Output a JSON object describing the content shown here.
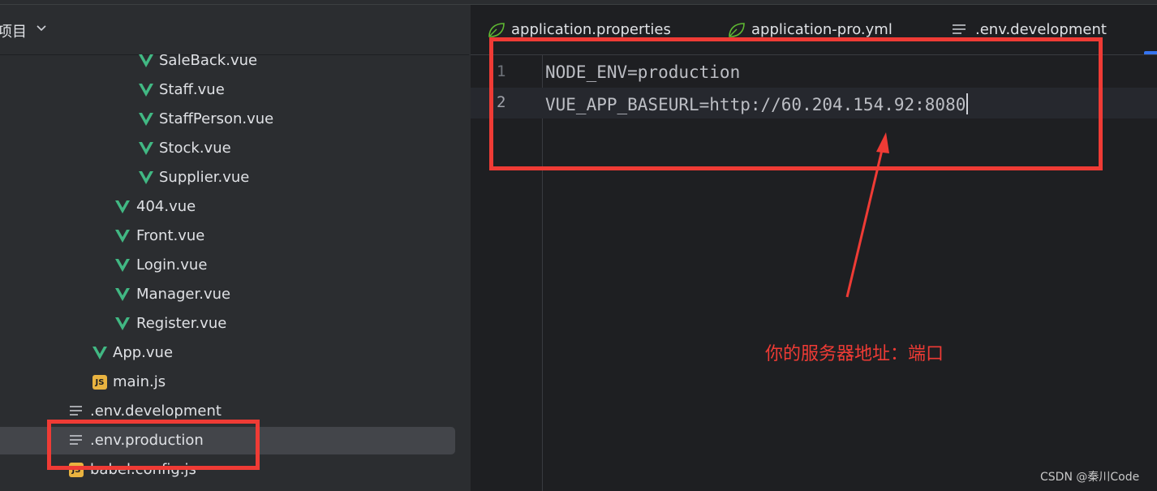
{
  "project_panel": {
    "title": "项目",
    "tree": [
      {
        "label": "SaleBack.vue",
        "icon": "vue-icon"
      },
      {
        "label": "Staff.vue",
        "icon": "vue-icon"
      },
      {
        "label": "StaffPerson.vue",
        "icon": "vue-icon"
      },
      {
        "label": "Stock.vue",
        "icon": "vue-icon"
      },
      {
        "label": "Supplier.vue",
        "icon": "vue-icon"
      },
      {
        "label": "404.vue",
        "icon": "vue-icon"
      },
      {
        "label": "Front.vue",
        "icon": "vue-icon"
      },
      {
        "label": "Login.vue",
        "icon": "vue-icon"
      },
      {
        "label": "Manager.vue",
        "icon": "vue-icon"
      },
      {
        "label": "Register.vue",
        "icon": "vue-icon"
      },
      {
        "label": "App.vue",
        "icon": "vue-icon"
      },
      {
        "label": "main.js",
        "icon": "js-icon"
      },
      {
        "label": ".env.development",
        "icon": "text-file-icon"
      },
      {
        "label": ".env.production",
        "icon": "text-file-icon",
        "selected": true
      },
      {
        "label": "babel.config.js",
        "icon": "js-icon"
      }
    ]
  },
  "editor": {
    "tabs": [
      {
        "label": "application.properties",
        "icon": "spring-leaf-icon"
      },
      {
        "label": "application-pro.yml",
        "icon": "spring-leaf-icon"
      },
      {
        "label": ".env.development",
        "icon": "text-file-icon"
      }
    ],
    "lines": [
      {
        "number": "1",
        "text": "NODE_ENV=production"
      },
      {
        "number": "2",
        "text": "VUE_APP_BASEURL=http://60.204.154.92:8080"
      }
    ]
  },
  "annotation": {
    "text": "你的服务器地址：端口",
    "color": "#ef3b35"
  },
  "watermark": "CSDN @秦川Code",
  "colors": {
    "vue_green": "#41b883",
    "js_yellow": "#e9b340",
    "accent_blue": "#3574f0"
  }
}
